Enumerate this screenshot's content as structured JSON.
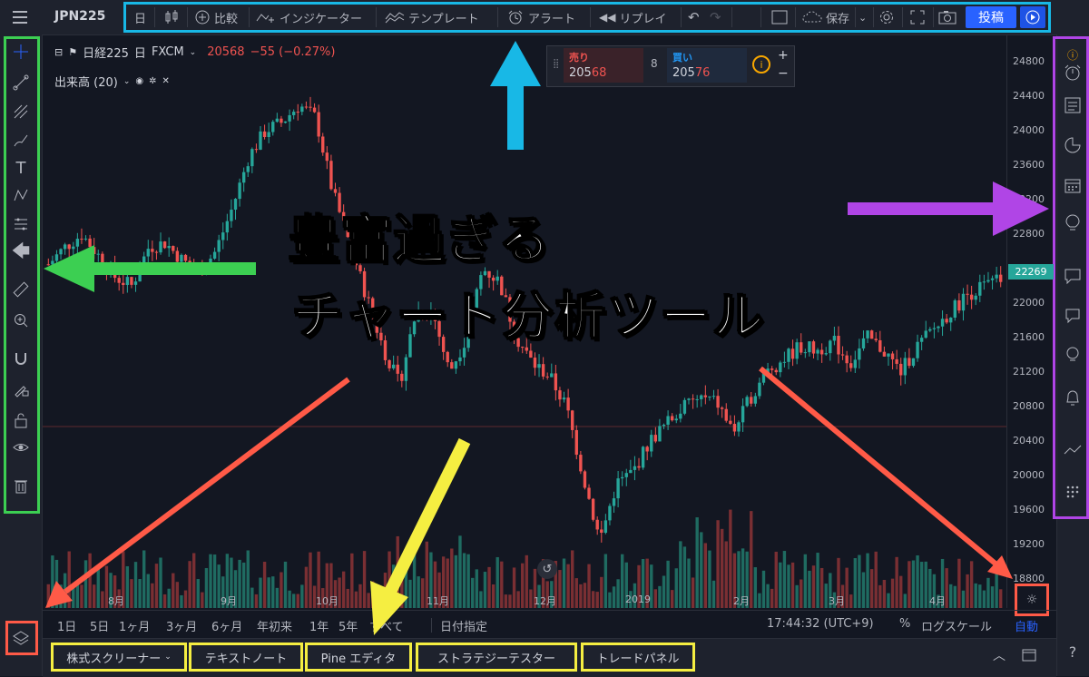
{
  "header": {
    "symbol": "JPN225",
    "toolbar": {
      "interval": "日",
      "compare": "比較",
      "indicators": "インジケーター",
      "templates": "テンプレート",
      "alert": "アラート",
      "replay": "リプレイ",
      "save": "保存",
      "post": "投稿"
    }
  },
  "legend": {
    "name": "日経225",
    "interval": "日",
    "source": "FXCM",
    "last_price": "20568",
    "change": "−55 (−0.27%)",
    "volume_label": "出来高 (20)"
  },
  "trade_widget": {
    "sell_label": "売り",
    "sell_price_main": "205",
    "sell_price_hl": "68",
    "spread": "8",
    "buy_label": "買い",
    "buy_price_main": "205",
    "buy_price_hl": "76"
  },
  "chart_data": {
    "type": "candlestick",
    "price_ticks": [
      24800,
      24400,
      24000,
      23600,
      23200,
      22800,
      22400,
      22000,
      21600,
      21200,
      20800,
      20400,
      20000,
      19600,
      19200,
      18800
    ],
    "x_ticks": [
      "8月",
      "9月",
      "10月",
      "11月",
      "12月",
      "2019",
      "2月",
      "3月",
      "4月"
    ],
    "current_price": "22269",
    "series_close": [
      22450,
      22650,
      22800,
      22550,
      22300,
      22200,
      22650,
      22700,
      22500,
      22350,
      22600,
      23100,
      23700,
      24000,
      24100,
      24300,
      24150,
      23300,
      22700,
      22100,
      21500,
      21050,
      21900,
      21900,
      21200,
      21600,
      22400,
      22250,
      21600,
      21300,
      21150,
      20800,
      20000,
      19250,
      19900,
      20050,
      20400,
      20600,
      20800,
      20900,
      20850,
      20500,
      20900,
      21200,
      21350,
      21500,
      21450,
      21550,
      21300,
      21600,
      21450,
      21200,
      21500,
      21700,
      21900,
      22100,
      22200,
      22269
    ]
  },
  "range_bar": {
    "ranges": [
      "1日",
      "5日",
      "1ヶ月",
      "3ヶ月",
      "6ヶ月",
      "年初来",
      "1年",
      "5年",
      "すべて"
    ],
    "date_specify": "日付指定",
    "time": "17:44:32 (UTC+9)",
    "percent": "%",
    "log_scale": "ログスケール",
    "auto": "自動"
  },
  "bottom_tabs": [
    "株式スクリーナー",
    "テキストノート",
    "Pine エディタ",
    "ストラテジーテスター",
    "トレードパネル"
  ],
  "annotation": {
    "line1": "豊富過ぎる",
    "line2": "チャート分析ツール"
  },
  "colors": {
    "up": "#26a69a",
    "down": "#ef5350",
    "cyan": "#18b8e6",
    "green": "#3ccf52",
    "purple": "#b045e6",
    "red": "#ff5a47",
    "yellow": "#f5ee41"
  }
}
